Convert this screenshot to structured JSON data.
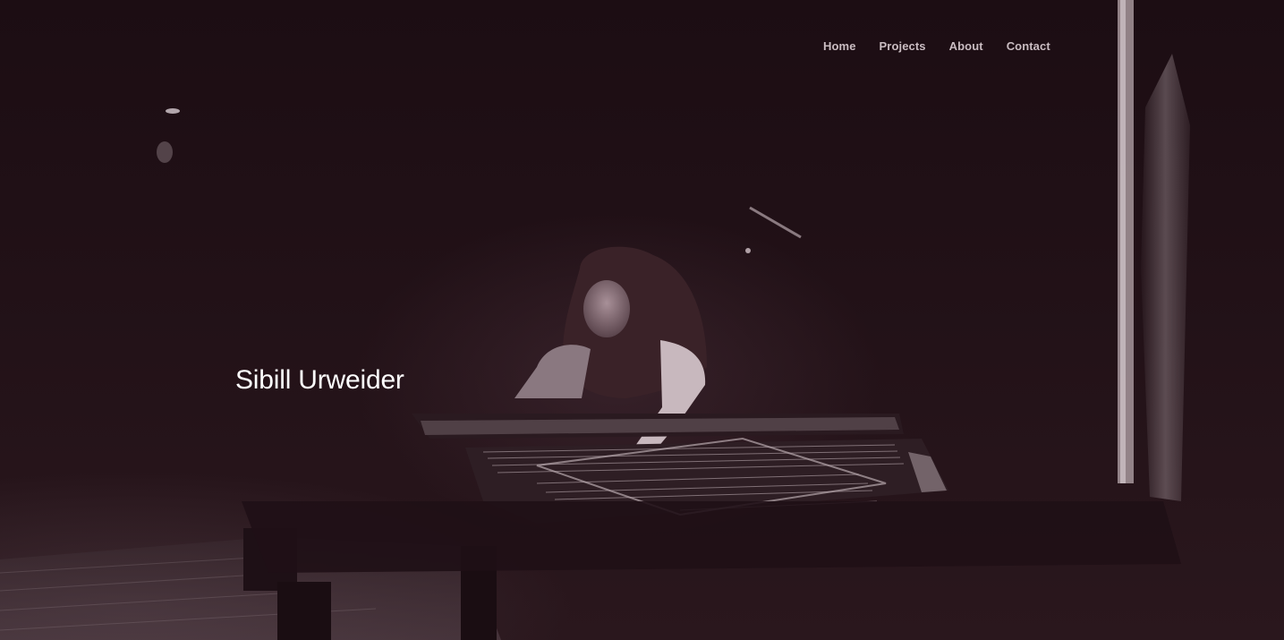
{
  "nav": {
    "items": [
      {
        "label": "Home"
      },
      {
        "label": "Projects"
      },
      {
        "label": "About"
      },
      {
        "label": "Contact"
      }
    ]
  },
  "hero": {
    "title": "Sibill Urweider",
    "image": "pianist-performing-grand-piano-photo",
    "tint_color": "#22121a",
    "title_color": "#ffffff",
    "nav_color": "#c9bcc1"
  }
}
